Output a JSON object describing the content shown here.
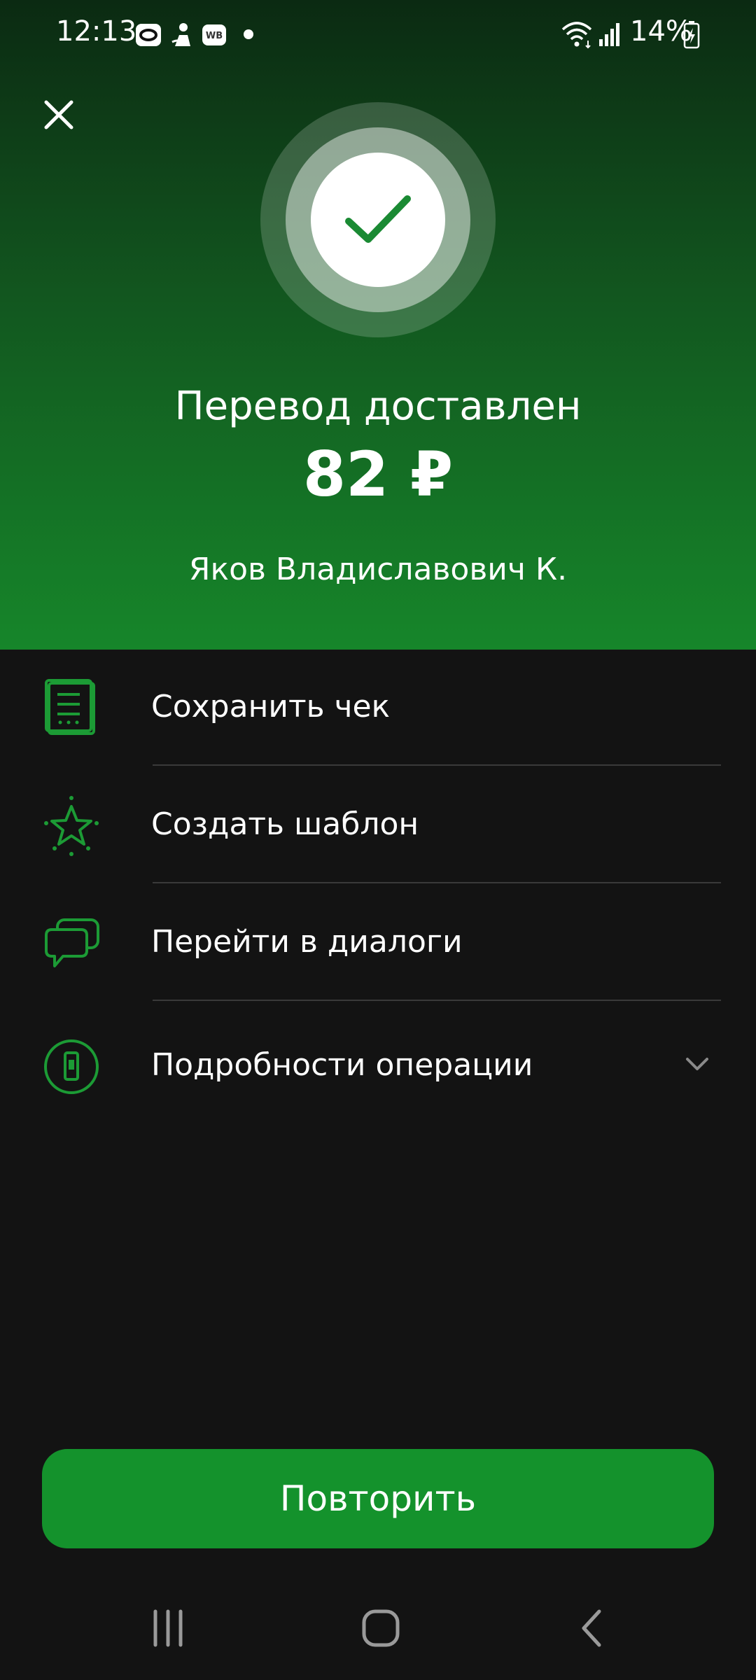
{
  "status_bar": {
    "time": "12:13",
    "battery": "14%",
    "icons": [
      "oval-app-icon",
      "person-app-icon",
      "wb-app-icon",
      "wifi-icon",
      "signal-icon",
      "battery-charging-icon"
    ]
  },
  "header": {
    "title": "Перевод доставлен",
    "amount": "82 ₽",
    "recipient": "Яков Владиславович К."
  },
  "actions": [
    {
      "label": "Сохранить чек",
      "icon": "receipt-icon"
    },
    {
      "label": "Создать шаблон",
      "icon": "star-icon"
    },
    {
      "label": "Перейти в диалоги",
      "icon": "chat-icon"
    },
    {
      "label": "Подробности операции",
      "icon": "phone-details-icon"
    }
  ],
  "primary_button": {
    "label": "Повторить"
  },
  "nav": [
    "recent-apps-icon",
    "home-icon",
    "back-icon"
  ],
  "colors": {
    "accent": "#14922c",
    "background": "#131313",
    "hero_top": "#0b2a12",
    "hero_bottom": "#16862a"
  }
}
